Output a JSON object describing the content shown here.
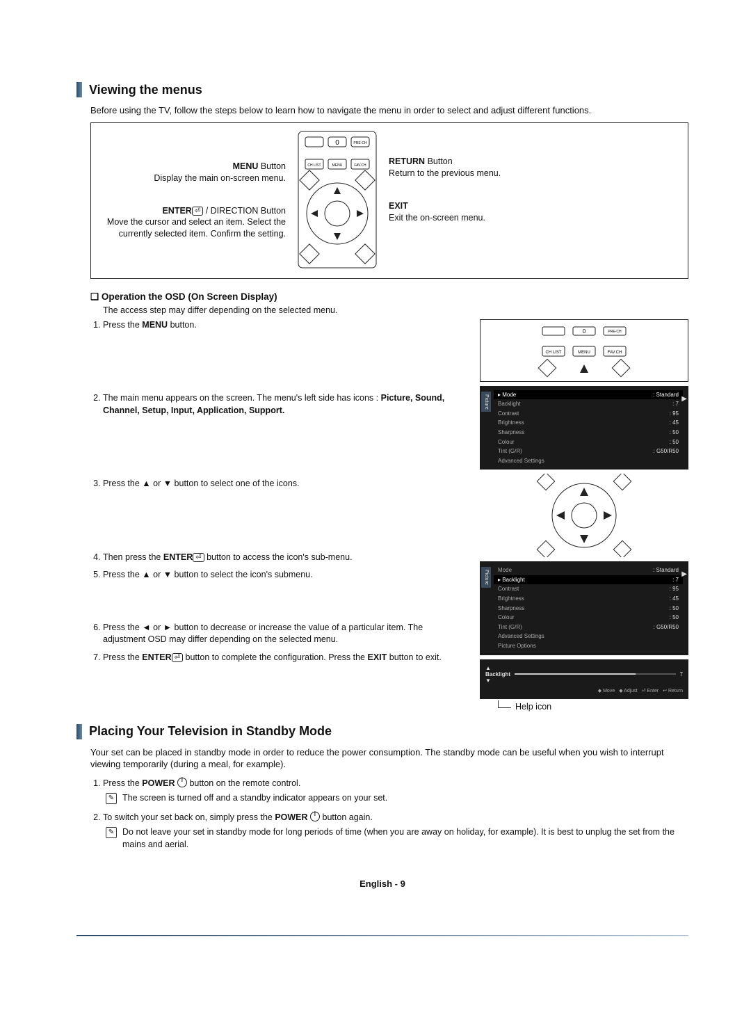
{
  "section1": {
    "title": "Viewing the menus",
    "intro": "Before using the TV, follow the steps below to learn how to navigate the menu in order to select and adjust different functions.",
    "left_blocks": {
      "menu_title": "MENU",
      "menu_suffix": " Button",
      "menu_desc": "Display the main on-screen menu.",
      "enter_title": "ENTER",
      "enter_suffix": " / DIRECTION Button",
      "enter_desc": "Move the cursor and select an item. Select the currently selected item. Confirm the setting."
    },
    "right_blocks": {
      "return_title": "RETURN",
      "return_suffix": " Button",
      "return_desc": "Return to the previous menu.",
      "exit_title": "EXIT",
      "exit_desc": "Exit the on-screen menu."
    },
    "remote_buttons": {
      "chlist": "CH LIST",
      "menu": "MENU",
      "favch": "FAV.CH",
      "prech": "PRE-CH"
    },
    "sub_heading": "Operation the OSD (On Screen Display)",
    "sub_text": "The access step may differ depending on the selected menu.",
    "steps": [
      {
        "pre": "Press the ",
        "bold": "MENU",
        "post": " button."
      },
      {
        "pre": "The main menu appears on the screen. The menu's left side has icons : ",
        "bold": "Picture, Sound, Channel, Setup, Input, Application, Support.",
        "post": ""
      },
      {
        "pre": "Press the ▲ or ▼ button to select one of the icons.",
        "bold": "",
        "post": ""
      },
      {
        "pre": "Then press the ",
        "bold": "ENTER",
        "enter": true,
        "post": " button to access the icon's sub-menu."
      },
      {
        "pre": "Press the ▲ or ▼ button to select the icon's submenu.",
        "bold": "",
        "post": ""
      },
      {
        "pre": "Press the ◄ or ► button to decrease or increase the value of a particular item. The adjustment OSD may differ depending on the selected menu.",
        "bold": "",
        "post": ""
      },
      {
        "pre": "Press the ",
        "bold": "ENTER",
        "enter": true,
        "post_mid": " button to complete the configuration. Press the ",
        "bold2": "EXIT",
        "post": " button to exit."
      }
    ],
    "osd": {
      "tab": "Picture",
      "rows": [
        {
          "label": "Mode",
          "value": ": Standard",
          "sel": true
        },
        {
          "label": "Backlight",
          "value": ": 7"
        },
        {
          "label": "Contrast",
          "value": ": 95"
        },
        {
          "label": "Brightness",
          "value": ": 45"
        },
        {
          "label": "Sharpness",
          "value": ": 50"
        },
        {
          "label": "Colour",
          "value": ": 50"
        },
        {
          "label": "Tint (G/R)",
          "value": ": G50/R50"
        },
        {
          "label": "Advanced Settings",
          "value": ""
        }
      ]
    },
    "osd2": {
      "rows": [
        {
          "label": "Mode",
          "value": ": Standard"
        },
        {
          "label": "Backlight",
          "value": ": 7",
          "sel": true
        },
        {
          "label": "Contrast",
          "value": ": 95"
        },
        {
          "label": "Brightness",
          "value": ": 45"
        },
        {
          "label": "Sharpness",
          "value": ": 50"
        },
        {
          "label": "Colour",
          "value": ": 50"
        },
        {
          "label": "Tint (G/R)",
          "value": ": G50/R50"
        },
        {
          "label": "Advanced Settings",
          "value": ""
        },
        {
          "label": "Picture Options",
          "value": ""
        }
      ]
    },
    "slider": {
      "label": "Backlight",
      "value": "7",
      "hints": [
        "◆ Move",
        "◆ Adjust",
        "⏎ Enter",
        "↩ Return"
      ]
    },
    "help_label": "Help icon"
  },
  "section2": {
    "title": "Placing Your Television in Standby Mode",
    "intro": "Your set can be placed in standby mode in order to reduce the power consumption. The standby mode can be useful when you wish to interrupt viewing temporarily (during a meal, for example).",
    "steps": [
      {
        "pre": "Press the ",
        "bold": "POWER",
        "power": true,
        "post": " button on the remote control.",
        "note": "The screen is turned off and a standby indicator appears on your set."
      },
      {
        "pre": "To switch your set back on, simply press the ",
        "bold": "POWER",
        "power": true,
        "post": " button again.",
        "note": "Do not leave your set in standby mode for long periods of time (when you are away on holiday, for example). It is best to unplug the set from the mains and aerial."
      }
    ]
  },
  "footer": "English - 9"
}
